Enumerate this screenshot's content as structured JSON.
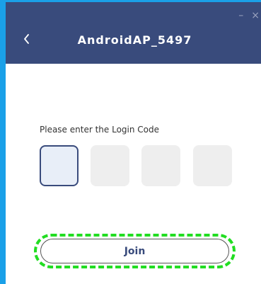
{
  "window": {
    "title": "AndroidAP_5497",
    "minimize_glyph": "–",
    "close_glyph": "×"
  },
  "header": {
    "back_icon": "chevron-left-icon"
  },
  "login": {
    "prompt": "Please enter the Login Code",
    "code_digits": [
      "",
      "",
      "",
      ""
    ],
    "join_label": "Join"
  },
  "colors": {
    "accent": "#394b7c",
    "outer_frame": "#1aa0e8",
    "highlight": "#22dd22"
  }
}
